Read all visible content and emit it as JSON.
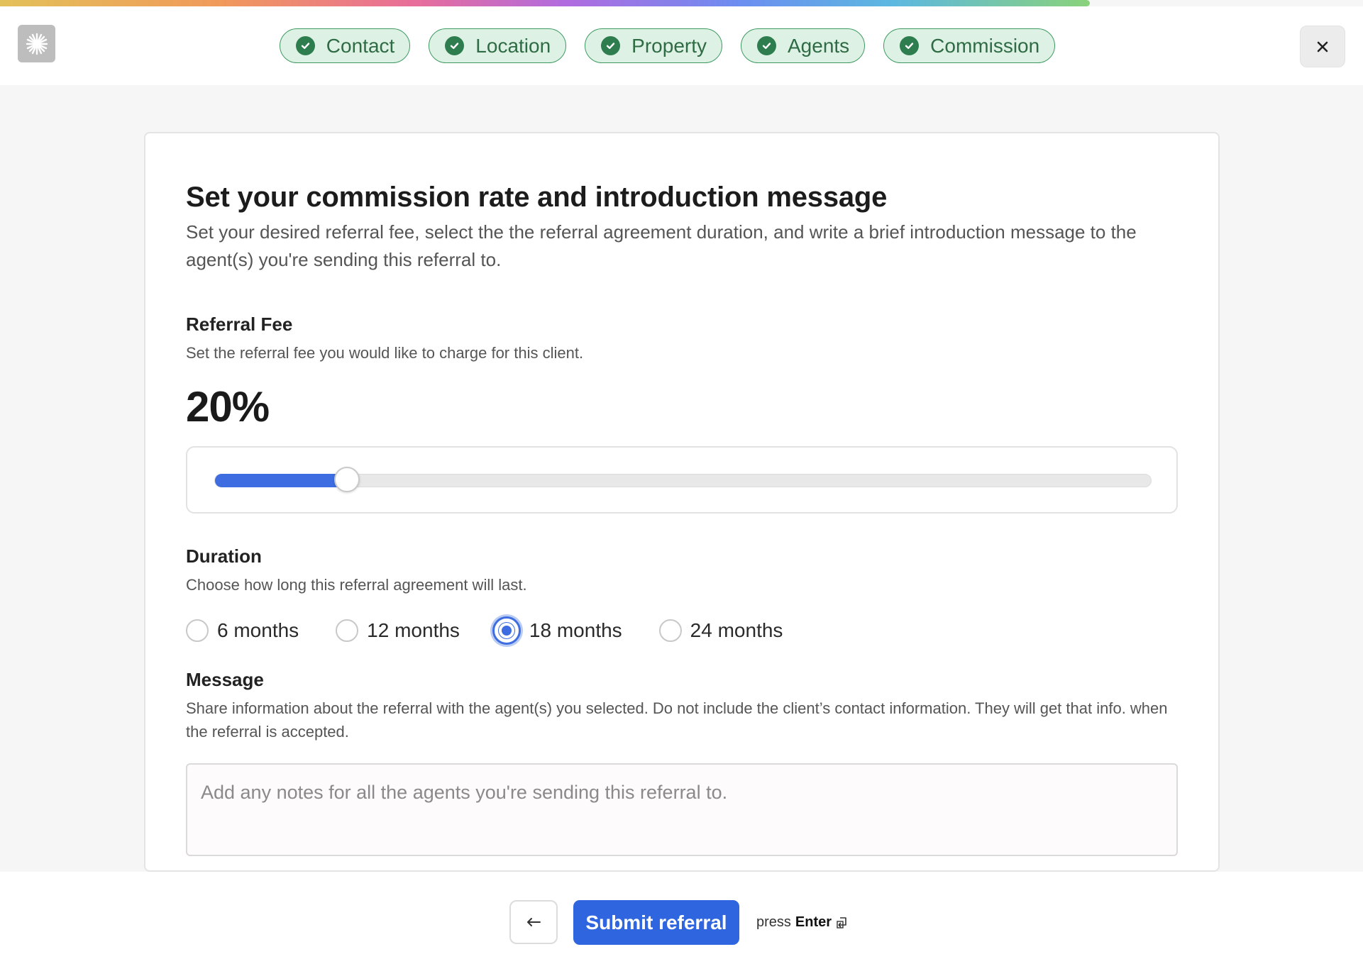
{
  "header": {
    "steps": [
      {
        "label": "Contact",
        "status": "complete"
      },
      {
        "label": "Location",
        "status": "complete"
      },
      {
        "label": "Property",
        "status": "complete"
      },
      {
        "label": "Agents",
        "status": "complete"
      },
      {
        "label": "Commission",
        "status": "complete"
      }
    ]
  },
  "page": {
    "title": "Set your commission rate and introduction message",
    "subtitle": "Set your desired referral fee, select the the referral agreement duration, and write a brief introduction message to the agent(s) you're sending this referral to."
  },
  "referral_fee": {
    "title": "Referral Fee",
    "description": "Set the referral fee you would like to charge for this client.",
    "value_display": "20%",
    "slider_fraction": 0.14
  },
  "duration": {
    "title": "Duration",
    "description": "Choose how long this referral agreement will last.",
    "options": [
      "6 months",
      "12 months",
      "18 months",
      "24 months"
    ],
    "selected": "18 months"
  },
  "message": {
    "title": "Message",
    "description": "Share information about the referral with the agent(s) you selected. Do not include the client’s contact information. They will get that info. when the referral is accepted.",
    "placeholder": "Add any notes for all the agents you're sending this referral to.",
    "value": ""
  },
  "footer": {
    "submit_label": "Submit referral",
    "hint_prefix": "press",
    "hint_key": "Enter"
  },
  "colors": {
    "accent": "#2f66e0",
    "step_border": "#3f9a62",
    "step_bg": "#ddf2e4",
    "check": "#2e7d4f"
  },
  "icons": {
    "logo": "sparkle-logo-icon",
    "close": "close-icon",
    "step_check": "check-circle-icon",
    "back": "arrow-left-icon",
    "enter": "enter-key-icon"
  }
}
